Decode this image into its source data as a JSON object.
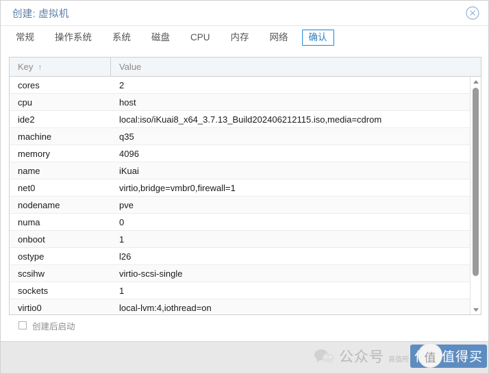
{
  "window": {
    "title": "创建: 虚拟机",
    "close_icon": "close-circle-icon"
  },
  "tabs": [
    {
      "label": "常规",
      "active": false
    },
    {
      "label": "操作系统",
      "active": false
    },
    {
      "label": "系统",
      "active": false
    },
    {
      "label": "磁盘",
      "active": false
    },
    {
      "label": "CPU",
      "active": false
    },
    {
      "label": "内存",
      "active": false
    },
    {
      "label": "网络",
      "active": false
    },
    {
      "label": "确认",
      "active": true
    }
  ],
  "grid": {
    "columns": [
      {
        "label": "Key",
        "sort_indicator": "↑"
      },
      {
        "label": "Value",
        "sort_indicator": ""
      }
    ],
    "rows": [
      {
        "key": "cores",
        "value": "2"
      },
      {
        "key": "cpu",
        "value": "host"
      },
      {
        "key": "ide2",
        "value": "local:iso/iKuai8_x64_3.7.13_Build202406212115.iso,media=cdrom"
      },
      {
        "key": "machine",
        "value": "q35"
      },
      {
        "key": "memory",
        "value": "4096"
      },
      {
        "key": "name",
        "value": "iKuai"
      },
      {
        "key": "net0",
        "value": "virtio,bridge=vmbr0,firewall=1"
      },
      {
        "key": "nodename",
        "value": "pve"
      },
      {
        "key": "numa",
        "value": "0"
      },
      {
        "key": "onboot",
        "value": "1"
      },
      {
        "key": "ostype",
        "value": "l26"
      },
      {
        "key": "scsihw",
        "value": "virtio-scsi-single"
      },
      {
        "key": "sockets",
        "value": "1"
      },
      {
        "key": "virtio0",
        "value": "local-lvm:4,iothread=on"
      }
    ],
    "scrollbar": {
      "up_icon": "scroll-up-arrow-icon",
      "down_icon": "scroll-down-arrow-icon"
    }
  },
  "options": {
    "start_after_create_label": "创建后启动",
    "start_after_create_checked": false
  },
  "watermark": {
    "wechat_icon": "wechat-icon",
    "account_text": "公众号",
    "sub_text": "高值所",
    "circle_text": "值",
    "badge_text": "什么值得买"
  },
  "colors": {
    "title": "#5b80a8",
    "active_tab": "#2e7fc4",
    "active_tab_border": "#3a96dd",
    "header_bg": "#f3f6f8",
    "badge_bg": "#5d8cc0"
  }
}
